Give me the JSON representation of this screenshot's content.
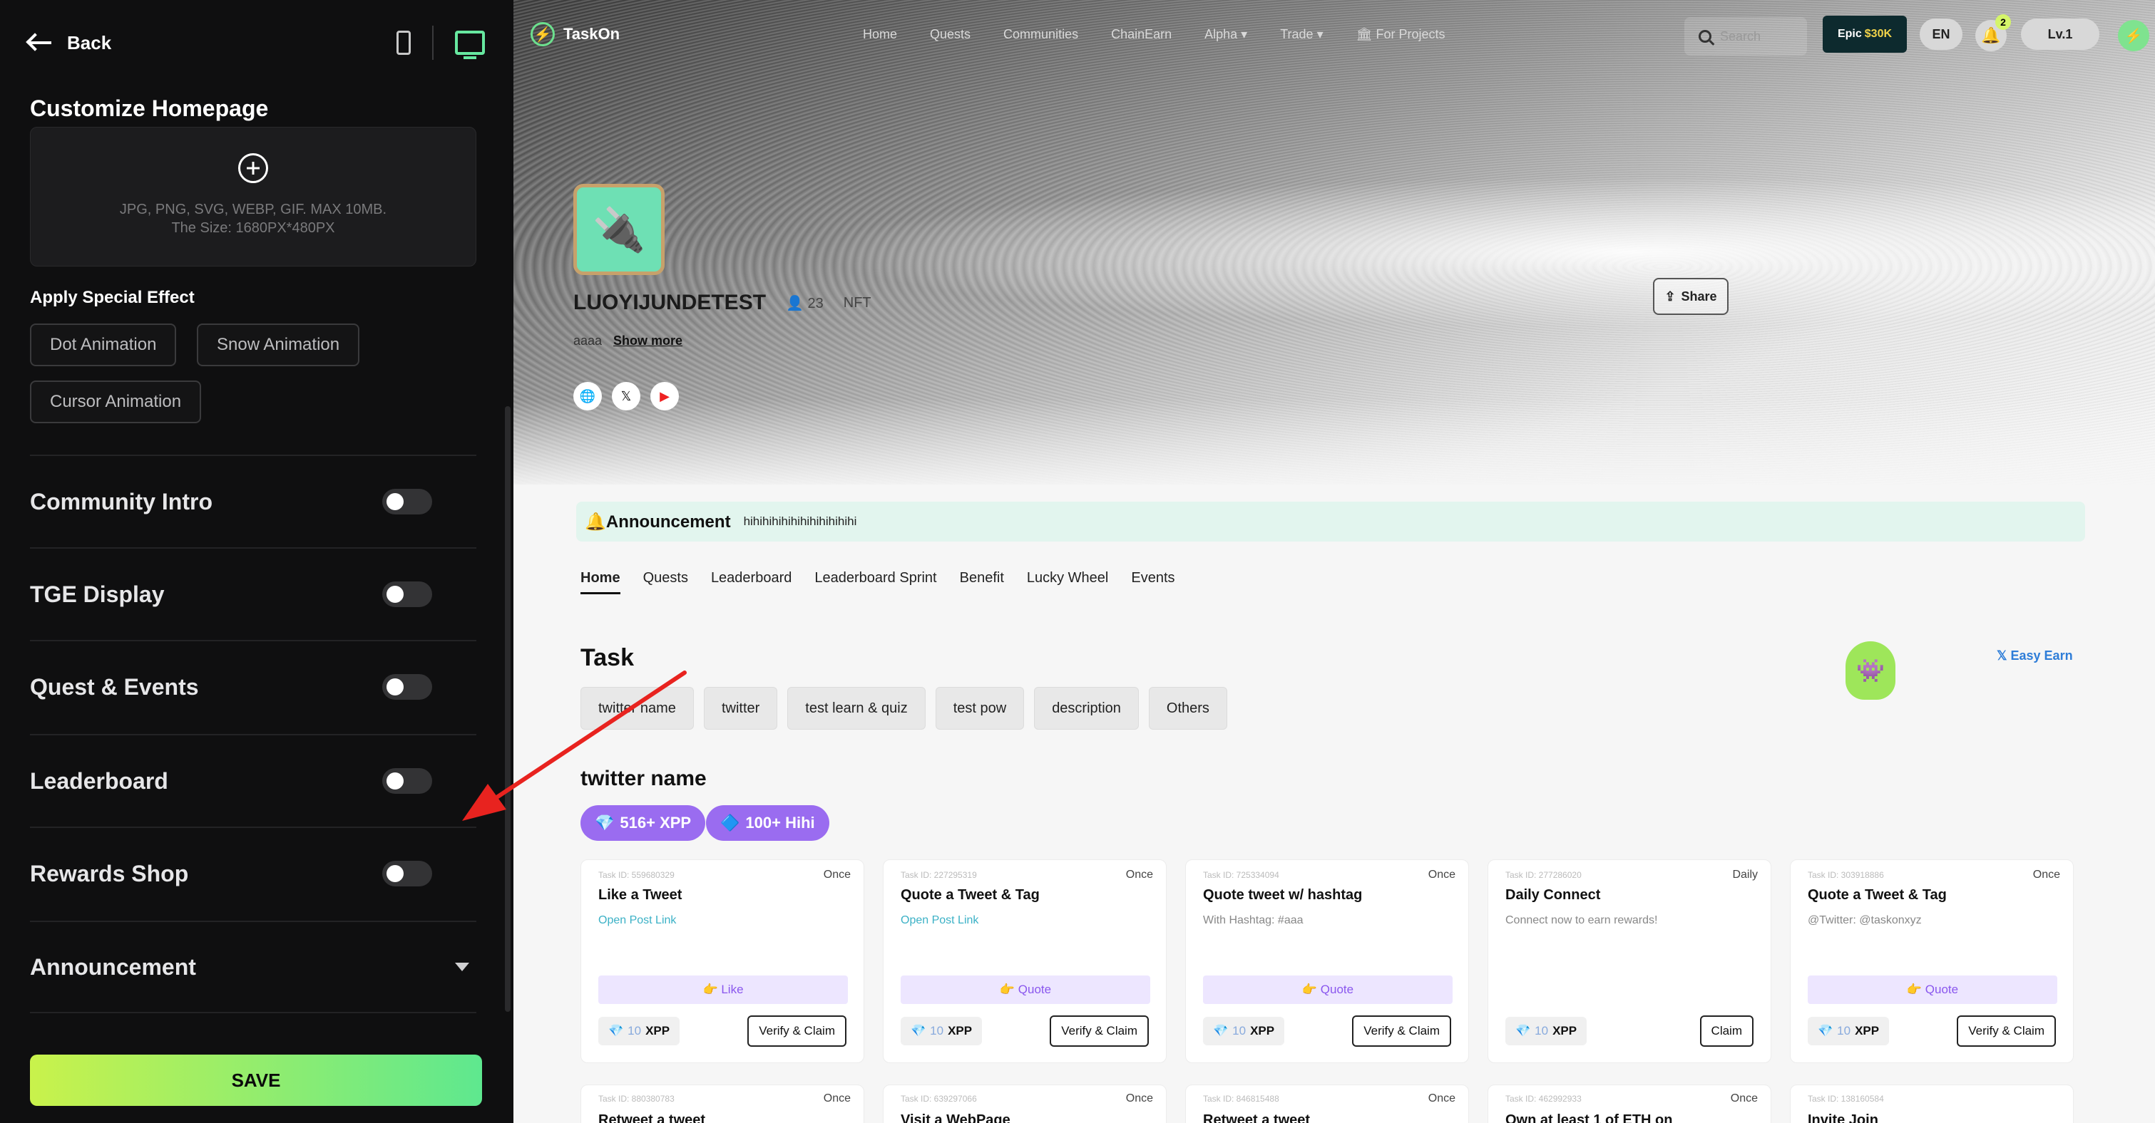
{
  "sidebar": {
    "back_label": "Back",
    "title": "Customize Homepage",
    "upload_formats": "JPG, PNG, SVG, WEBP, GIF. MAX 10MB.",
    "upload_size": "The Size: 1680PX*480PX",
    "effect_title": "Apply Special Effect",
    "effects": [
      "Dot Animation",
      "Snow Animation",
      "Cursor Animation"
    ],
    "sections": [
      "Community Intro",
      "TGE Display",
      "Quest & Events",
      "Leaderboard",
      "Rewards Shop"
    ],
    "section_toggles_on": [
      false,
      false,
      false,
      false,
      false
    ],
    "announcement_label": "Announcement",
    "save_label": "SAVE",
    "accent_gradient": [
      "#c9f24b",
      "#5ee88f"
    ]
  },
  "nav": {
    "brand": "TaskOn",
    "links": [
      "Home",
      "Quests",
      "Communities",
      "ChainEarn",
      "Alpha ▾",
      "Trade ▾",
      "🏛 For Projects"
    ],
    "search_placeholder": "Search",
    "epic_prefix": "Epic",
    "epic_amount": "$30K",
    "lang": "EN",
    "notif_count": "2",
    "level": "Lv.1"
  },
  "community": {
    "name": "LUOYIJUNDETEST",
    "members": "23",
    "tag": "NFT",
    "desc_snippet": "aaaa",
    "show_more": "Show more",
    "share_label": "Share"
  },
  "announcement": {
    "title": "Announcement",
    "content": "hihihihihihihihihihihihi"
  },
  "tabs": [
    "Home",
    "Quests",
    "Leaderboard",
    "Leaderboard Sprint",
    "Benefit",
    "Lucky Wheel",
    "Events"
  ],
  "task_section": {
    "title": "Task",
    "filters": [
      "twitter name",
      "twitter",
      "test learn & quiz",
      "test pow",
      "description",
      "Others"
    ],
    "easy_earn": "Easy Earn",
    "group_title": "twitter name",
    "group_rewards": [
      "516+ XPP",
      "100+ Hihi"
    ]
  },
  "cards": [
    {
      "id": "Task ID: 559680329",
      "freq": "Once",
      "title": "Like a Tweet",
      "sub": "Open Post Link",
      "sub_link": true,
      "action": "👉 Like",
      "reward_num": "10",
      "reward_unit": "XPP",
      "button": "Verify & Claim"
    },
    {
      "id": "Task ID: 227295319",
      "freq": "Once",
      "title": "Quote a Tweet & Tag",
      "sub": "Open Post Link",
      "sub_link": true,
      "action": "👉 Quote",
      "reward_num": "10",
      "reward_unit": "XPP",
      "button": "Verify & Claim"
    },
    {
      "id": "Task ID: 725334094",
      "freq": "Once",
      "title": "Quote tweet w/ hashtag",
      "sub": "With Hashtag: #aaa",
      "sub_link": false,
      "action": "👉 Quote",
      "reward_num": "10",
      "reward_unit": "XPP",
      "button": "Verify & Claim"
    },
    {
      "id": "Task ID: 277286020",
      "freq": "Daily",
      "title": "Daily Connect",
      "sub": "Connect now to earn rewards!",
      "sub_link": false,
      "action": "",
      "reward_num": "10",
      "reward_unit": "XPP",
      "button": "Claim"
    },
    {
      "id": "Task ID: 303918886",
      "freq": "Once",
      "title": "Quote a Tweet & Tag",
      "sub": "@Twitter: @taskonxyz",
      "sub_link": false,
      "action": "👉 Quote",
      "reward_num": "10",
      "reward_unit": "XPP",
      "button": "Verify & Claim"
    }
  ],
  "cards_row2": [
    {
      "id": "Task ID: 880380783",
      "freq": "Once",
      "title": "Retweet a tweet"
    },
    {
      "id": "Task ID: 639297066",
      "freq": "Once",
      "title": "Visit a WebPage"
    },
    {
      "id": "Task ID: 846815488",
      "freq": "Once",
      "title": "Retweet a tweet"
    },
    {
      "id": "Task ID: 462992933",
      "freq": "Once",
      "title": "Own at least 1 of ETH on"
    },
    {
      "id": "Task ID: 138160584",
      "freq": "",
      "title": "Invite Join"
    }
  ]
}
